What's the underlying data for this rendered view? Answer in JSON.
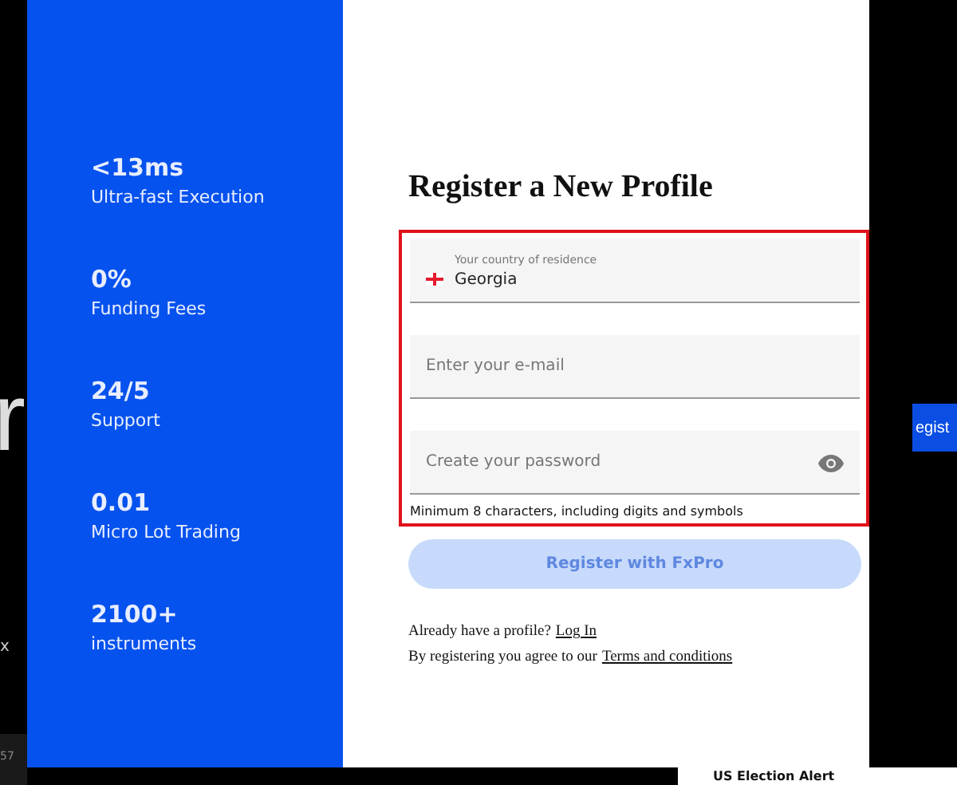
{
  "backdrop": {
    "left_text": "r",
    "left_close": "x",
    "left_footer": "57",
    "right_button": "egist",
    "bottom_card": "US Election Alert"
  },
  "promo": {
    "stats": [
      {
        "value": "<13ms",
        "label": "Ultra-fast Execution"
      },
      {
        "value": "0%",
        "label": "Funding Fees"
      },
      {
        "value": "24/5",
        "label": "Support"
      },
      {
        "value": "0.01",
        "label": "Micro Lot Trading"
      },
      {
        "value": "2100+",
        "label": "instruments"
      }
    ]
  },
  "form": {
    "title": "Register a New Profile",
    "highlighted": true,
    "country": {
      "label": "Your country of residence",
      "value": "Georgia"
    },
    "email": {
      "placeholder": "Enter your e-mail"
    },
    "password": {
      "placeholder": "Create your password"
    },
    "hint": "Minimum 8 characters, including digits and symbols",
    "submit": {
      "label": "Register with FxPro",
      "disabled": true
    },
    "login_prompt": "Already have a profile?",
    "login_link": "Log In",
    "terms_prompt": "By registering you agree to our",
    "terms_link": "Terms and conditions"
  }
}
